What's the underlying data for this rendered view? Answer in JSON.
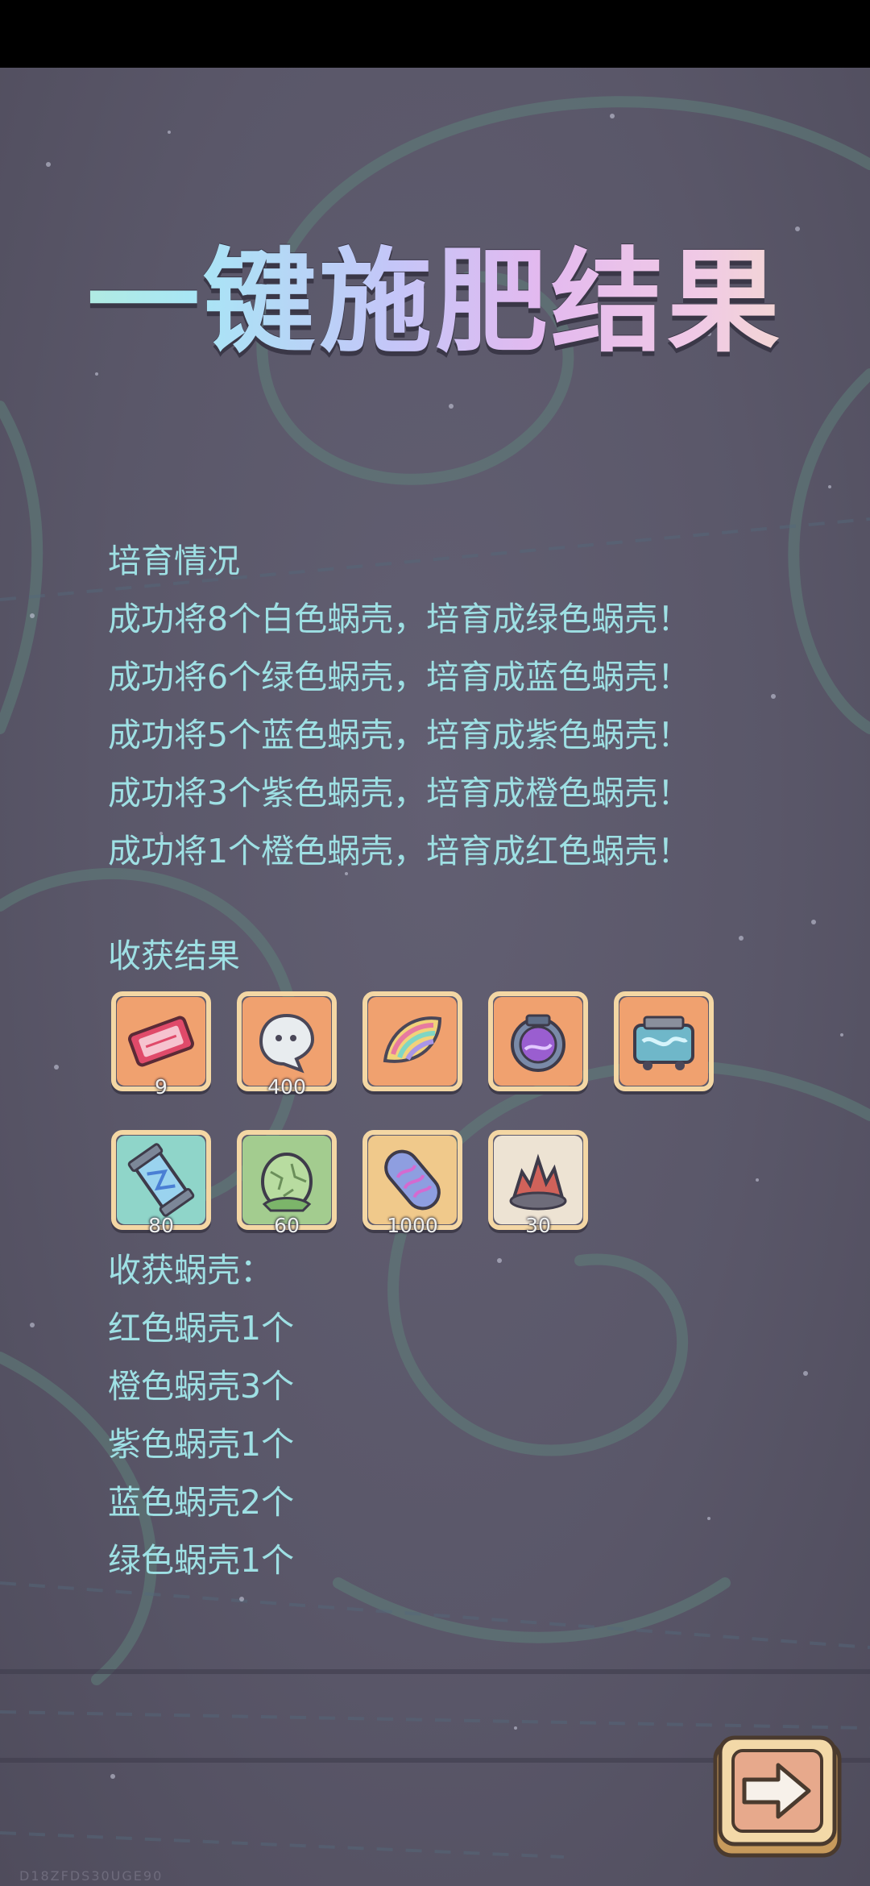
{
  "title": "一键施肥结果",
  "breeding": {
    "heading": "培育情况",
    "lines": [
      "成功将8个白色蜗壳，培育成绿色蜗壳！",
      "成功将6个绿色蜗壳，培育成蓝色蜗壳！",
      "成功将5个蓝色蜗壳，培育成紫色蜗壳！",
      "成功将3个紫色蜗壳，培育成橙色蜗壳！",
      "成功将1个橙色蜗壳，培育成红色蜗壳！"
    ]
  },
  "harvest": {
    "heading": "收获结果",
    "items": [
      {
        "icon": "ticket-icon",
        "qty": "9",
        "bg": "#f0a16f"
      },
      {
        "icon": "ghost-bubble-icon",
        "qty": "400",
        "bg": "#f0a16f"
      },
      {
        "icon": "rainbow-shell-icon",
        "qty": "",
        "bg": "#f0a16f"
      },
      {
        "icon": "purple-jar-icon",
        "qty": "",
        "bg": "#f0a16f"
      },
      {
        "icon": "blue-machine-icon",
        "qty": "",
        "bg": "#f0a16f"
      },
      {
        "icon": "blue-capsule-icon",
        "qty": "80",
        "bg": "#8fd5c9"
      },
      {
        "icon": "green-egg-icon",
        "qty": "60",
        "bg": "#a3cc8f"
      },
      {
        "icon": "purple-pill-icon",
        "qty": "1000",
        "bg": "#f0c98b"
      },
      {
        "icon": "red-crystal-icon",
        "qty": "30",
        "bg": "#ede3d3"
      }
    ]
  },
  "shells": {
    "heading": "收获蜗壳：",
    "lines": [
      "红色蜗壳1个",
      "橙色蜗壳3个",
      "紫色蜗壳1个",
      "蓝色蜗壳2个",
      "绿色蜗壳1个"
    ]
  },
  "next_button": {
    "icon": "arrow-right-icon"
  },
  "watermark": "D18ZFDS30UGE90"
}
